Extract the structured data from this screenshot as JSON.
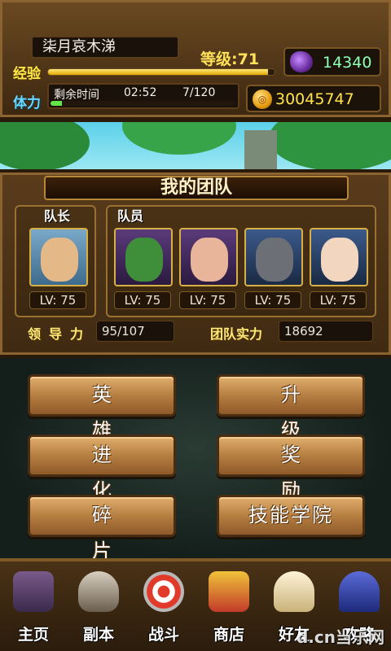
{
  "player": {
    "name": "柒月哀木涕",
    "level_text": "等级:71",
    "exp_label": "经验",
    "exp_progress": 0.97,
    "gems": "14340",
    "stamina_label": "体力",
    "stamina_remaining_label": "剩余时间",
    "stamina_timer": "02:52",
    "stamina_count": "7/120",
    "stamina_progress": 0.06,
    "gold": "30045747"
  },
  "team": {
    "title": "我的团队",
    "leader_tag": "队长",
    "members_tag": "队员",
    "leader_level": "LV: 75",
    "member_levels": [
      "LV: 75",
      "LV: 75",
      "LV: 75",
      "LV: 75"
    ],
    "leadership_label": "领导力",
    "leadership_value": "95/107",
    "power_label": "团队实力",
    "power_value": "18692"
  },
  "menu": {
    "heroes": "英雄",
    "upgrade": "升级",
    "evolve": "进化",
    "rewards": "奖励",
    "fragments": "碎片",
    "skill_academy": "技能学院"
  },
  "nav": [
    "主页",
    "副本",
    "战斗",
    "商店",
    "好友",
    "攻略"
  ],
  "watermark": "d.cn当乐网"
}
